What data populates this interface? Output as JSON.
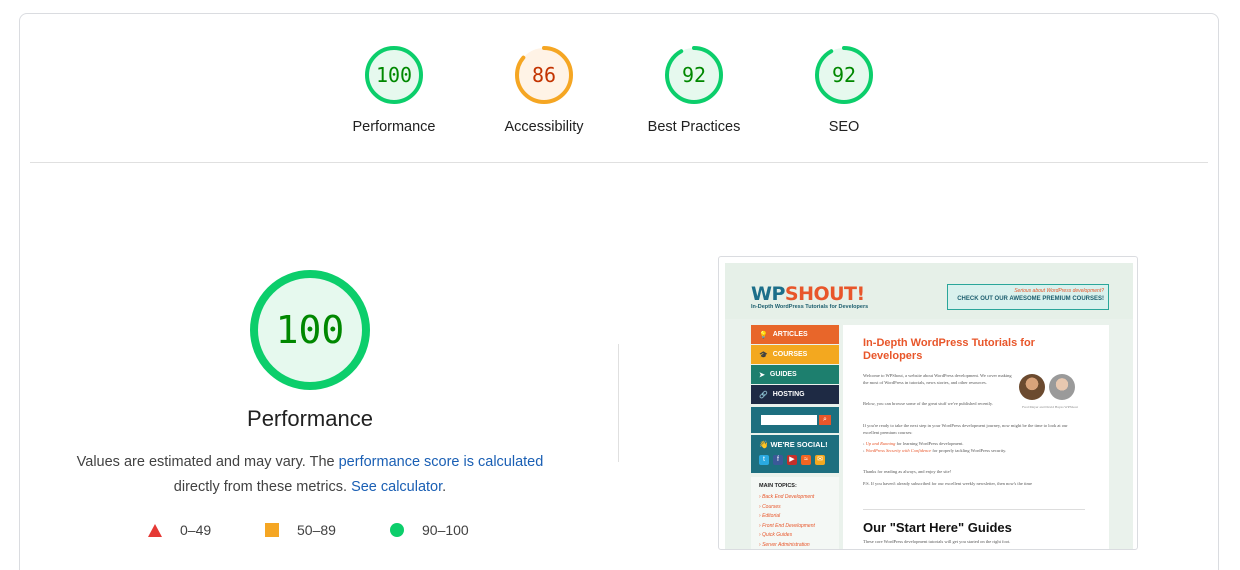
{
  "colors": {
    "pass": "#0cce6b",
    "average": "#ffa400",
    "fail": "#ff4e42",
    "link": "#1a5fb4"
  },
  "summary_gauges": [
    {
      "score": "100",
      "label": "Performance",
      "value_fraction": 1.0,
      "rating": "pass"
    },
    {
      "score": "86",
      "label": "Accessibility",
      "value_fraction": 0.86,
      "rating": "average"
    },
    {
      "score": "92",
      "label": "Best Practices",
      "value_fraction": 0.92,
      "rating": "pass"
    },
    {
      "score": "92",
      "label": "SEO",
      "value_fraction": 0.92,
      "rating": "pass"
    }
  ],
  "main": {
    "score": "100",
    "title": "Performance",
    "desc_prefix": "Values are estimated and may vary. The ",
    "desc_link": "performance score is calculated",
    "desc_middle": " directly from these metrics. ",
    "desc_calc_link": "See calculator",
    "desc_suffix": "."
  },
  "legend": [
    {
      "icon": "triangle-icon",
      "range": "0–49"
    },
    {
      "icon": "square-icon",
      "range": "50–89"
    },
    {
      "icon": "circle-icon",
      "range": "90–100"
    }
  ],
  "screenshot": {
    "logo_wp": "WP",
    "logo_shout": "SHOUT!",
    "tagline": "In-Depth WordPress Tutorials for Developers",
    "promo_line1": "Serious about WordPress development?",
    "promo_line2": "CHECK OUT OUR AWESOME PREMIUM COURSES!",
    "nav": [
      {
        "label": "ARTICLES",
        "color": "#e8662a",
        "icon": "💡"
      },
      {
        "label": "COURSES",
        "color": "#f3a81f",
        "icon": "🎓"
      },
      {
        "label": "GUIDES",
        "color": "#1d7f6e",
        "icon": "➤"
      },
      {
        "label": "HOSTING",
        "color": "#1e2a44",
        "icon": "🔗"
      }
    ],
    "social_title": "WE'RE SOCIAL!",
    "topics_title": "MAIN TOPICS:",
    "topics": [
      "Back End Development",
      "Courses",
      "Editorial",
      "Front End Development",
      "Quick Guides",
      "Server Administration"
    ],
    "heading": "In-Depth WordPress Tutorials for Developers",
    "intro": "Welcome to WPShout, a website about WordPress development. We cover making the most of WordPress in tutorials, news stories, and other resources.",
    "intro2": "Below, you can browse some of the great stuff we've published recently.",
    "intro3": "If you're ready to take the next step in your WordPress development journey, now might be the time to look at our excellent premium courses:",
    "course1": "Up and Running",
    "course1_rest": " for learning WordPress development.",
    "course2": "WordPress Security with Confidence",
    "course2_rest": " for properly tackling WordPress security.",
    "thanks": "Thanks for reading as always, and enjoy the site!",
    "ps": "P.S. If you haven't already subscribed for our excellent weekly newsletter, then now's the time",
    "authors": "Fred Meyer and David Hayes",
    "authors_suffix": "WPShout",
    "section_heading": "Our \"Start Here\" Guides",
    "section_text": "These core WordPress development tutorials will get you started on the right foot."
  }
}
